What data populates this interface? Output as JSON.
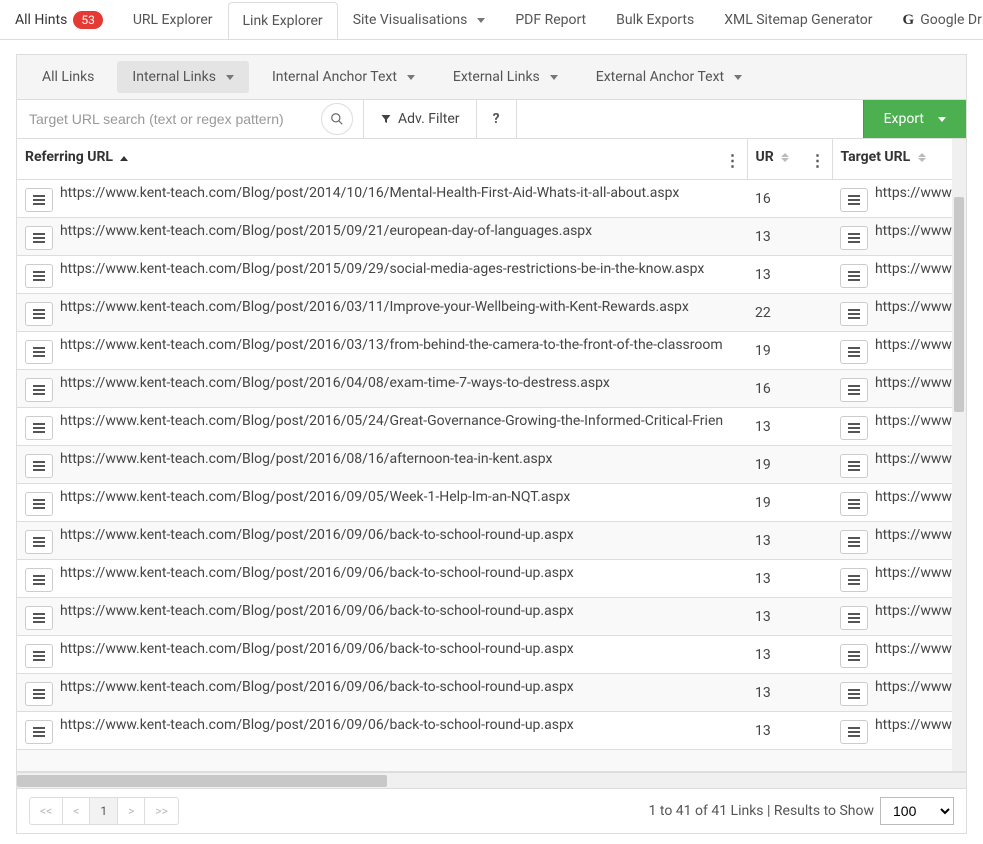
{
  "topTabs": {
    "allHints": "All Hints",
    "allHintsBadge": "53",
    "urlExplorer": "URL Explorer",
    "linkExplorer": "Link Explorer",
    "siteVis": "Site Visualisations",
    "pdfReport": "PDF Report",
    "bulkExports": "Bulk Exports",
    "xml": "XML Sitemap Generator",
    "gdrive": "Google Drive"
  },
  "subTabs": {
    "allLinks": "All Links",
    "internalLinks": "Internal Links",
    "internalAnchor": "Internal Anchor Text",
    "externalLinks": "External Links",
    "externalAnchor": "External Anchor Text"
  },
  "toolbar": {
    "searchPlaceholder": "Target URL search (text or regex pattern)",
    "advFilter": "Adv. Filter",
    "help": "?",
    "export": "Export"
  },
  "columns": {
    "referring": "Referring URL",
    "ur": "UR",
    "target": "Target URL"
  },
  "rows": [
    {
      "ref": "https://www.kent-teach.com/Blog/post/2014/10/16/Mental-Health-First-Aid-Whats-it-all-about.aspx",
      "ur": "16",
      "target": "https://www."
    },
    {
      "ref": "https://www.kent-teach.com/Blog/post/2015/09/21/european-day-of-languages.aspx",
      "ur": "13",
      "target": "https://www."
    },
    {
      "ref": "https://www.kent-teach.com/Blog/post/2015/09/29/social-media-ages-restrictions-be-in-the-know.aspx",
      "ur": "13",
      "target": "https://www."
    },
    {
      "ref": "https://www.kent-teach.com/Blog/post/2016/03/11/Improve-your-Wellbeing-with-Kent-Rewards.aspx",
      "ur": "22",
      "target": "https://www."
    },
    {
      "ref": "https://www.kent-teach.com/Blog/post/2016/03/13/from-behind-the-camera-to-the-front-of-the-classroom",
      "ur": "19",
      "target": "https://www."
    },
    {
      "ref": "https://www.kent-teach.com/Blog/post/2016/04/08/exam-time-7-ways-to-destress.aspx",
      "ur": "16",
      "target": "https://www."
    },
    {
      "ref": "https://www.kent-teach.com/Blog/post/2016/05/24/Great-Governance-Growing-the-Informed-Critical-Frien",
      "ur": "13",
      "target": "https://www."
    },
    {
      "ref": "https://www.kent-teach.com/Blog/post/2016/08/16/afternoon-tea-in-kent.aspx",
      "ur": "19",
      "target": "https://www."
    },
    {
      "ref": "https://www.kent-teach.com/Blog/post/2016/09/05/Week-1-Help-Im-an-NQT.aspx",
      "ur": "19",
      "target": "https://www."
    },
    {
      "ref": "https://www.kent-teach.com/Blog/post/2016/09/06/back-to-school-round-up.aspx",
      "ur": "13",
      "target": "https://www."
    },
    {
      "ref": "https://www.kent-teach.com/Blog/post/2016/09/06/back-to-school-round-up.aspx",
      "ur": "13",
      "target": "https://www."
    },
    {
      "ref": "https://www.kent-teach.com/Blog/post/2016/09/06/back-to-school-round-up.aspx",
      "ur": "13",
      "target": "https://www."
    },
    {
      "ref": "https://www.kent-teach.com/Blog/post/2016/09/06/back-to-school-round-up.aspx",
      "ur": "13",
      "target": "https://www."
    },
    {
      "ref": "https://www.kent-teach.com/Blog/post/2016/09/06/back-to-school-round-up.aspx",
      "ur": "13",
      "target": "https://www."
    },
    {
      "ref": "https://www.kent-teach.com/Blog/post/2016/09/06/back-to-school-round-up.aspx",
      "ur": "13",
      "target": "https://www."
    }
  ],
  "footer": {
    "page": "1",
    "summary": "1 to 41 of 41 Links | Results to Show",
    "pageSize": "100"
  }
}
